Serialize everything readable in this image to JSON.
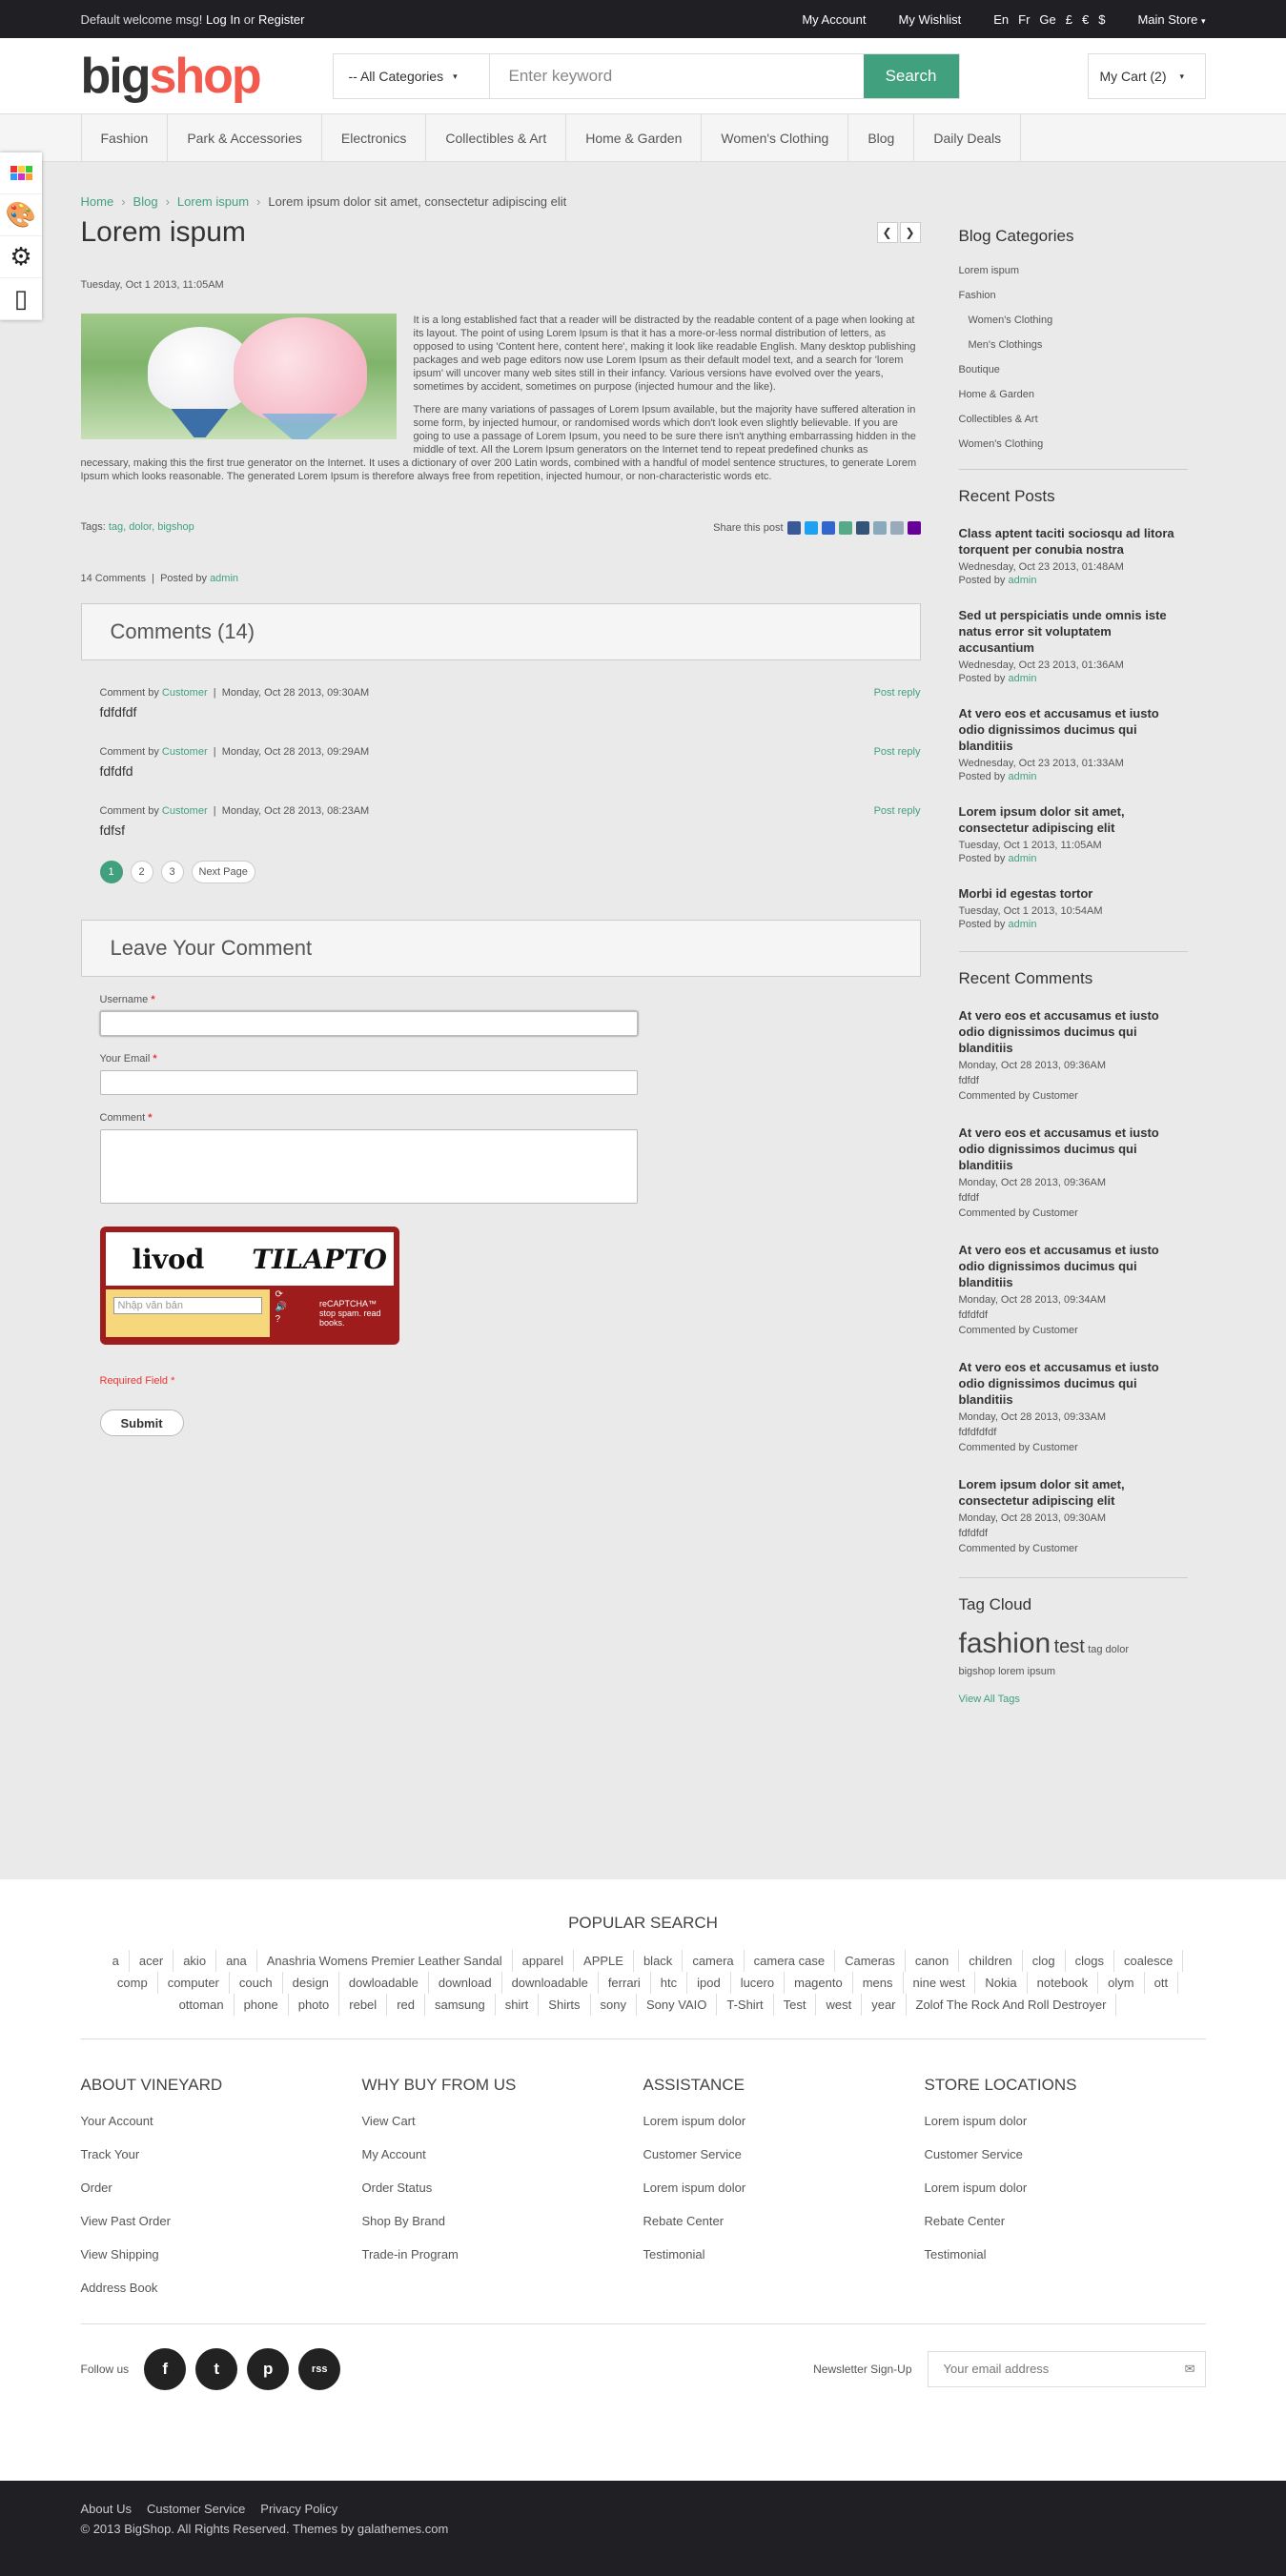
{
  "topbar": {
    "welcome": "Default welcome msg!",
    "login": "Log In",
    "or": "or",
    "register": "Register",
    "account": "My Account",
    "wishlist": "My Wishlist",
    "langs": [
      "En",
      "Fr",
      "Ge"
    ],
    "currencies": [
      "£",
      "€",
      "$"
    ],
    "store": "Main Store"
  },
  "header": {
    "logo_a": "big",
    "logo_b": "shop",
    "category": "-- All Categories",
    "search_placeholder": "Enter keyword",
    "search_btn": "Search",
    "cart": "My Cart (2)"
  },
  "nav": [
    "Fashion",
    "Park & Accessories",
    "Electronics",
    "Collectibles & Art",
    "Home & Garden",
    "Women's Clothing",
    "Blog",
    "Daily Deals"
  ],
  "breadcrumb": {
    "home": "Home",
    "blog": "Blog",
    "cat": "Lorem ispum",
    "current": "Lorem ipsum dolor sit amet, consectetur adipiscing elit"
  },
  "post": {
    "title": "Lorem ispum",
    "date": "Tuesday, Oct 1 2013, 11:05AM",
    "p1": "It is a long established fact that a reader will be distracted by the readable content of a page when looking at its layout. The point of using Lorem Ipsum is that it has a more-or-less normal distribution of letters, as opposed to using 'Content here, content here', making it look like readable English. Many desktop publishing packages and web page editors now use Lorem Ipsum as their default model text, and a search for 'lorem ipsum' will uncover many web sites still in their infancy. Various versions have evolved over the years, sometimes by accident, sometimes on purpose (injected humour and the like).",
    "p2": "There are many variations of passages of Lorem Ipsum available, but the majority have suffered alteration in some form, by injected humour, or randomised words which don't look even slightly believable. If you are going to use a passage of Lorem Ipsum, you need to be sure there isn't anything embarrassing hidden in the middle of text. All the Lorem Ipsum generators on the Internet tend to repeat predefined chunks as necessary, making this the first true generator on the Internet. It uses a dictionary of over 200 Latin words, combined with a handful of model sentence structures, to generate Lorem Ipsum which looks reasonable. The generated Lorem Ipsum is therefore always free from repetition, injected humour, or non-characteristic words etc.",
    "tags_label": "Tags:",
    "tags": "tag, dolor, bigshop",
    "share": "Share this post",
    "comments_count": "14 Comments",
    "posted_by": "Posted by",
    "author": "admin"
  },
  "comments": {
    "title": "Comments (14)",
    "items": [
      {
        "by": "Comment by",
        "user": "Customer",
        "date": "Monday, Oct 28 2013, 09:30AM",
        "text": "fdfdfdf",
        "reply": "Post reply"
      },
      {
        "by": "Comment by",
        "user": "Customer",
        "date": "Monday, Oct 28 2013, 09:29AM",
        "text": "fdfdfd",
        "reply": "Post reply"
      },
      {
        "by": "Comment by",
        "user": "Customer",
        "date": "Monday, Oct 28 2013, 08:23AM",
        "text": "fdfsf",
        "reply": "Post reply"
      }
    ],
    "pages": [
      "1",
      "2",
      "3",
      "Next Page"
    ]
  },
  "form": {
    "title": "Leave Your Comment",
    "username": "Username",
    "email": "Your Email",
    "comment": "Comment",
    "captcha_w1": "livod",
    "captcha_w2": "TILAPTO",
    "captcha_placeholder": "Nhập văn bản",
    "captcha_brand": "reCAPTCHA™ stop spam. read books.",
    "required": "Required Field *",
    "submit": "Submit"
  },
  "sidebar": {
    "cat_title": "Blog Categories",
    "cats": [
      "Lorem ispum",
      "Fashion",
      "Women's Clothing",
      "Men's Clothings",
      "Boutique",
      "Home & Garden",
      "Collectibles & Art",
      "Women's Clothing"
    ],
    "recent_title": "Recent Posts",
    "posts": [
      {
        "t": "Class aptent taciti sociosqu ad litora torquent per conubia nostra",
        "d": "Wednesday, Oct 23 2013, 01:48AM"
      },
      {
        "t": "Sed ut perspiciatis unde omnis iste natus error sit voluptatem accusantium",
        "d": "Wednesday, Oct 23 2013, 01:36AM"
      },
      {
        "t": "At vero eos et accusamus et iusto odio dignissimos ducimus qui blanditiis",
        "d": "Wednesday, Oct 23 2013, 01:33AM"
      },
      {
        "t": "Lorem ipsum dolor sit amet, consectetur adipiscing elit",
        "d": "Tuesday, Oct 1 2013, 11:05AM"
      },
      {
        "t": "Morbi id egestas tortor",
        "d": "Tuesday, Oct 1 2013, 10:54AM"
      }
    ],
    "posted_by": "Posted by",
    "admin": "admin",
    "rc_title": "Recent Comments",
    "rcs": [
      {
        "t": "At vero eos et accusamus et iusto odio dignissimos ducimus qui blanditiis",
        "d": "Monday, Oct 28 2013, 09:36AM",
        "x": "fdfdf"
      },
      {
        "t": "At vero eos et accusamus et iusto odio dignissimos ducimus qui blanditiis",
        "d": "Monday, Oct 28 2013, 09:36AM",
        "x": "fdfdf"
      },
      {
        "t": "At vero eos et accusamus et iusto odio dignissimos ducimus qui blanditiis",
        "d": "Monday, Oct 28 2013, 09:34AM",
        "x": "fdfdfdf"
      },
      {
        "t": "At vero eos et accusamus et iusto odio dignissimos ducimus qui blanditiis",
        "d": "Monday, Oct 28 2013, 09:33AM",
        "x": "fdfdfdfdf"
      },
      {
        "t": "Lorem ipsum dolor sit amet, consectetur adipiscing elit",
        "d": "Monday, Oct 28 2013, 09:30AM",
        "x": "fdfdfdf"
      }
    ],
    "commented_by": "Commented by Customer",
    "tag_title": "Tag Cloud",
    "tag_a": "fashion",
    "tag_b": "test",
    "tag_c": "tag dolor",
    "tag_d": "bigshop lorem ipsum",
    "view_all": "View All Tags"
  },
  "footer": {
    "popular_title": "POPULAR SEARCH",
    "popular": [
      "a",
      "acer",
      "akio",
      "ana",
      "Anashria Womens Premier Leather Sandal",
      "apparel",
      "APPLE",
      "black",
      "camera",
      "camera case",
      "Cameras",
      "canon",
      "children",
      "clog",
      "clogs",
      "coalesce",
      "comp",
      "computer",
      "couch",
      "design",
      "dowloadable",
      "download",
      "downloadable",
      "ferrari",
      "htc",
      "ipod",
      "lucero",
      "magento",
      "mens",
      "nine west",
      "Nokia",
      "notebook",
      "olym",
      "ott",
      "ottoman",
      "phone",
      "photo",
      "rebel",
      "red",
      "samsung",
      "shirt",
      "Shirts",
      "sony",
      "Sony VAIO",
      "T-Shirt",
      "Test",
      "west",
      "year",
      "Zolof The Rock And Roll Destroyer"
    ],
    "cols": [
      {
        "title": "ABOUT VINEYARD",
        "items": [
          "Your Account",
          "Track Your",
          "Order",
          "View Past Order",
          "View Shipping",
          "Address Book"
        ]
      },
      {
        "title": "WHY BUY FROM US",
        "items": [
          "View Cart",
          "My Account",
          "Order Status",
          "Shop By Brand",
          "Trade-in Program"
        ]
      },
      {
        "title": "ASSISTANCE",
        "items": [
          "Lorem ispum dolor",
          "Customer Service",
          "Lorem ispum dolor",
          "Rebate Center",
          "Testimonial"
        ]
      },
      {
        "title": "STORE LOCATIONS",
        "items": [
          "Lorem ispum dolor",
          "Customer Service",
          "Lorem ispum dolor",
          "Rebate Center",
          "Testimonial"
        ]
      }
    ],
    "follow": "Follow us",
    "social": [
      "f",
      "t",
      "p",
      "rss"
    ],
    "newsletter": "Newsletter Sign-Up",
    "email_placeholder": "Your email address",
    "bottom_links": [
      "About Us",
      "Customer Service",
      "Privacy Policy"
    ],
    "copyright": "© 2013 BigShop. All Rights Reserved. Themes by galathemes.com"
  }
}
